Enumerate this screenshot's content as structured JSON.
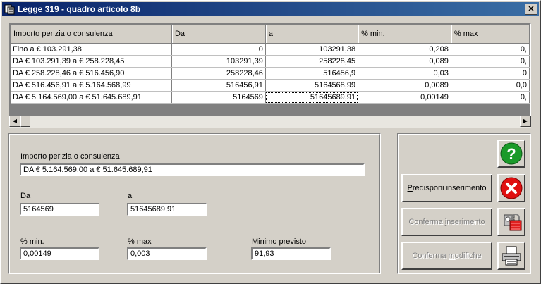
{
  "window": {
    "title": "Legge 319 - quadro articolo 8b",
    "close_glyph": "✕"
  },
  "grid": {
    "columns": [
      "Importo perizia o consulenza",
      "Da",
      "a",
      "% min.",
      "% max"
    ],
    "rows": [
      [
        "Fino a € 103.291,38",
        "0",
        "103291,38",
        "0,208",
        "0,"
      ],
      [
        "DA € 103.291,39 a € 258.228,45",
        "103291,39",
        "258228,45",
        "0,089",
        "0,"
      ],
      [
        "DA € 258.228,46 a € 516.456,90",
        "258228,46",
        "516456,9",
        "0,03",
        "0"
      ],
      [
        "DA € 516.456,91 a € 5.164.568,99",
        "516456,91",
        "5164568,99",
        "0,0089",
        "0,0"
      ],
      [
        "DA € 5.164.569,00 a € 51.645.689,91",
        "5164569",
        "51645689,91",
        "0,00149",
        "0,"
      ]
    ]
  },
  "form": {
    "importo_label": "Importo perizia o consulenza",
    "importo_value": "DA € 5.164.569,00 a € 51.645.689,91",
    "da_label": "Da",
    "da_value": "5164569",
    "a_label": "a",
    "a_value": "51645689,91",
    "min_label": "% min.",
    "min_value": "0,00149",
    "max_label": "% max",
    "max_value": "0,003",
    "minimo_label": "Minimo previsto",
    "minimo_value": "91,93"
  },
  "buttons": {
    "predisponi_first": "P",
    "predisponi_rest": "redisponi inserimento",
    "conferma_ins_pre": "Conferma ",
    "conferma_ins_u": "i",
    "conferma_ins_post": "nserimento",
    "conferma_mod_pre": "Conferma ",
    "conferma_mod_u": "m",
    "conferma_mod_post": "odifiche"
  },
  "icons": {
    "help": "help-icon",
    "cancel": "cancel-icon",
    "lock": "lock-icon",
    "printer": "printer-icon"
  },
  "colors": {
    "title_bar": "#0a246a",
    "help_green": "#1a9a2a",
    "cancel_red": "#e01010"
  }
}
